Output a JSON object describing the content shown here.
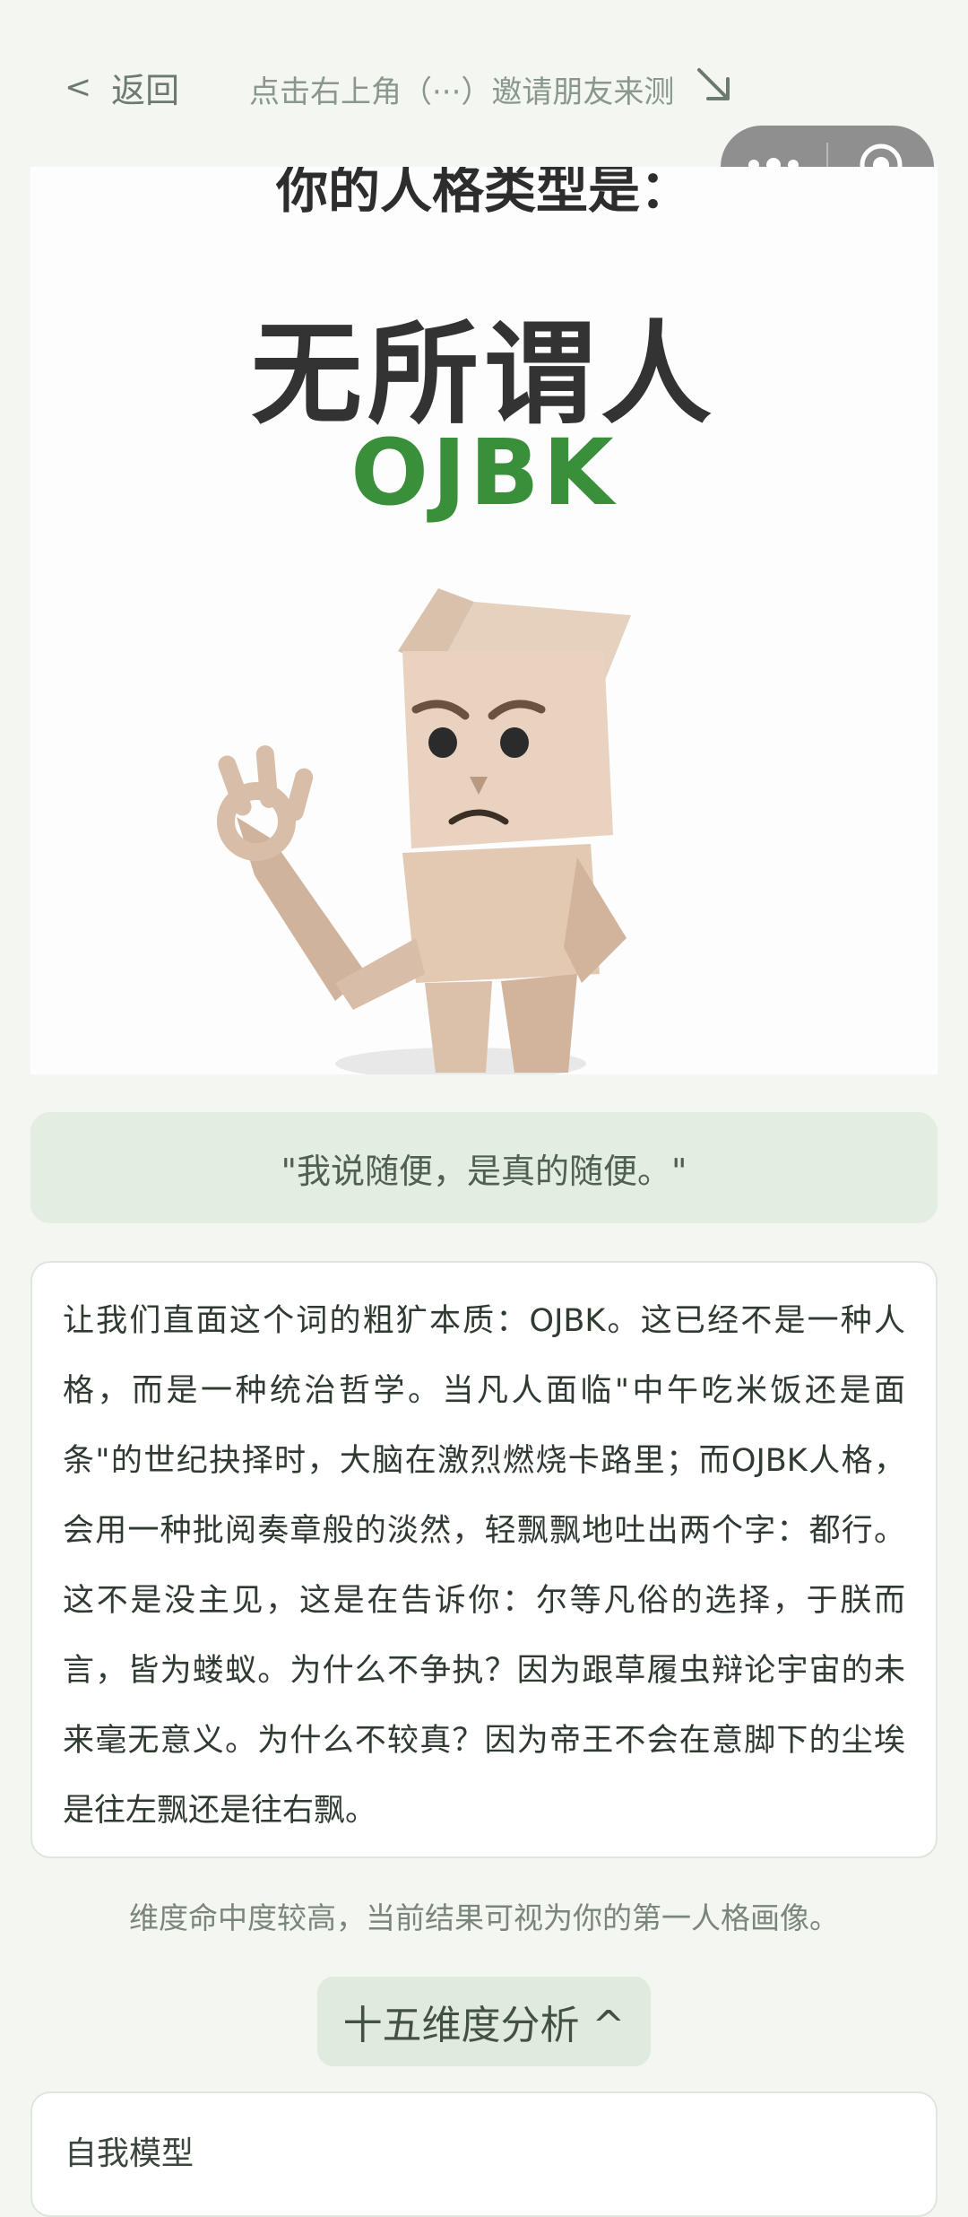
{
  "nav": {
    "back_label": "返回",
    "back_chevron": "<",
    "invite_text": "点击右上角（···）邀请朋友来测",
    "invite_arrow": "↘"
  },
  "capsule": {
    "more_icon": "more-dots-icon",
    "close_icon": "target-circle-icon"
  },
  "hero": {
    "top_text": "你的人格类型是：",
    "type_name": "无所谓人",
    "type_code": "OJBK"
  },
  "quote": "\"我说随便，是真的随便。\"",
  "description": "让我们直面这个词的粗犷本质：OJBK。这已经不是一种人格，而是一种统治哲学。当凡人面临\"中午吃米饭还是面条\"的世纪抉择时，大脑在激烈燃烧卡路里；而OJBK人格，会用一种批阅奏章般的淡然，轻飘飘地吐出两个字：都行。这不是没主见，这是在告诉你：尔等凡俗的选择，于朕而言，皆为蝼蚁。为什么不争执？因为跟草履虫辩论宇宙的未来毫无意义。为什么不较真？因为帝王不会在意脚下的尘埃是往左飘还是往右飘。",
  "note": "维度命中度较高，当前结果可视为你的第一人格画像。",
  "dimension_button": "十五维度分析 ^",
  "model_card": {
    "title": "自我模型"
  },
  "colors": {
    "background": "#f3f6f1",
    "accent_green": "#3a8f3a",
    "quote_bg": "#e3ede1"
  }
}
